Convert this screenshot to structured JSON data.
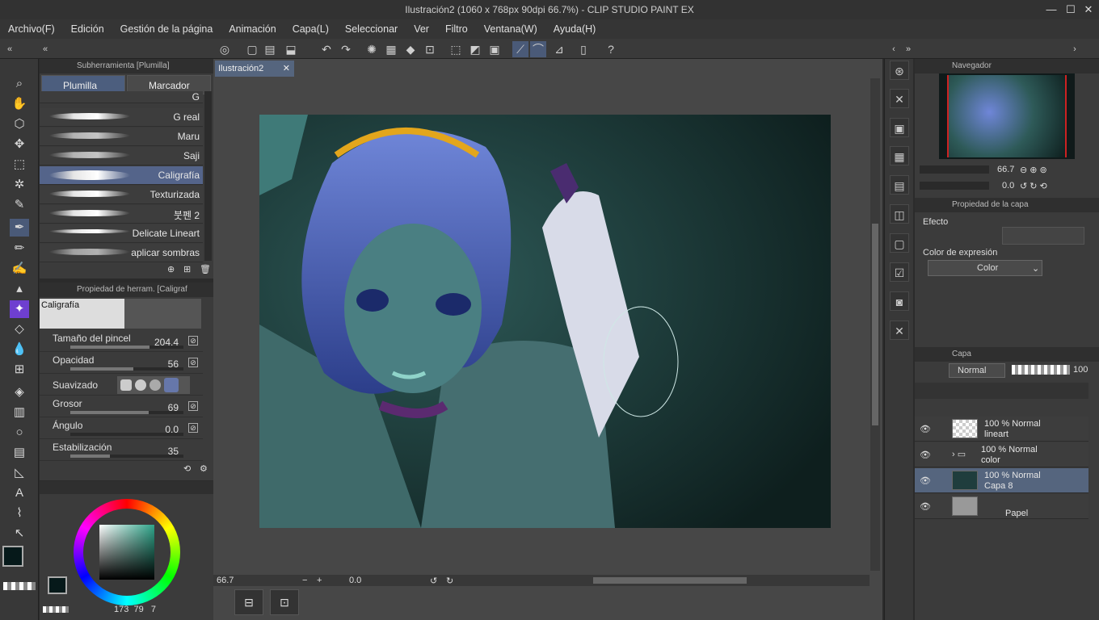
{
  "window": {
    "title": "Ilustración2 (1060 x 768px 90dpi 66.7%) - CLIP STUDIO PAINT EX",
    "min": "—",
    "max": "☐",
    "close": "✕"
  },
  "menu": [
    "Archivo(F)",
    "Edición",
    "Gestión de la página",
    "Animación",
    "Capa(L)",
    "Seleccionar",
    "Ver",
    "Filtro",
    "Ventana(W)",
    "Ayuda(H)"
  ],
  "subtool": {
    "header": "Subherramienta [Plumilla]",
    "tabs": [
      "Plumilla",
      "Marcador"
    ],
    "brushes": [
      "G",
      "G real",
      "Maru",
      "Saji",
      "Caligrafía",
      "Texturizada",
      "붓펜 2",
      "Delicate Lineart",
      "aplicar sombras"
    ],
    "selected_brush": "Caligrafía"
  },
  "toolprop": {
    "header": "Propiedad de herram. [Caligraf",
    "preview_label": "Caligrafía",
    "rows": [
      {
        "label": "Tamaño del pincel",
        "value": "204.4",
        "fill": 0.7
      },
      {
        "label": "Opacidad",
        "value": "56",
        "fill": 0.56
      },
      {
        "label": "Suavizado",
        "value": "",
        "fill": 0
      },
      {
        "label": "Grosor",
        "value": "69",
        "fill": 0.69
      },
      {
        "label": "Ángulo",
        "value": "0.0",
        "fill": 0
      },
      {
        "label": "Estabilización",
        "value": "35",
        "fill": 0.35
      }
    ]
  },
  "color": {
    "main": "#06191a",
    "sub": "#000000",
    "wheel_square": "#2fa58a",
    "readout": [
      "173",
      "79",
      "7"
    ]
  },
  "canvas": {
    "tab": "Ilustración2",
    "zoom": "66.7",
    "rotation": "0.0"
  },
  "navigator": {
    "header": "Navegador",
    "zoom": "66.7",
    "angle": "0.0"
  },
  "layerprop": {
    "header": "Propiedad de la capa",
    "effect_label": "Efecto",
    "expr_label": "Color de expresión",
    "expr_value": "Color"
  },
  "layers": {
    "header": "Capa",
    "blend": "Normal",
    "opacity": "100",
    "items": [
      {
        "line1": "100 % Normal",
        "line2": "lineart"
      },
      {
        "line1": "100 % Normal",
        "line2": "color"
      },
      {
        "line1": "100 % Normal",
        "line2": "Capa 8"
      },
      {
        "line1": "",
        "line2": "Papel"
      }
    ]
  }
}
